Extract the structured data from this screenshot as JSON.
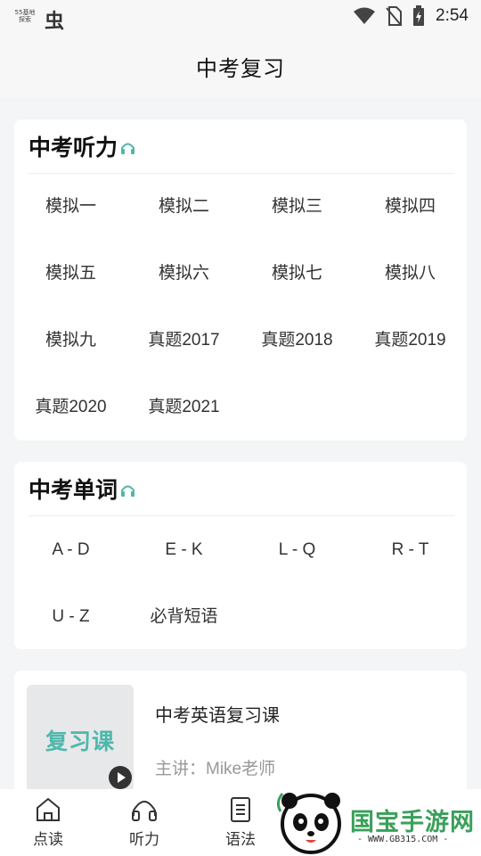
{
  "status_bar": {
    "mini_logo_line1": "55基地",
    "mini_logo_line2": "探索",
    "bug_glyph": "虫",
    "time": "2:54"
  },
  "header": {
    "title": "中考复习"
  },
  "listening": {
    "title": "中考听力",
    "items": [
      "模拟一",
      "模拟二",
      "模拟三",
      "模拟四",
      "模拟五",
      "模拟六",
      "模拟七",
      "模拟八",
      "模拟九",
      "真题2017",
      "真题2018",
      "真题2019",
      "真题2020",
      "真题2021"
    ]
  },
  "words": {
    "title": "中考单词",
    "items": [
      "A - D",
      "E - K",
      "L - Q",
      "R - T",
      "U - Z",
      "必背短语"
    ]
  },
  "course": {
    "thumb_text": "复习课",
    "title": "中考英语复习课",
    "teacher": "主讲：Mike老师"
  },
  "tabbar": {
    "items": [
      {
        "label": "点读",
        "icon": "home-icon"
      },
      {
        "label": "听力",
        "icon": "headphones-icon"
      },
      {
        "label": "语法",
        "icon": "document-icon"
      }
    ]
  },
  "watermark": {
    "brand": "国宝手游网",
    "url": "- WWW.GB315.COM -"
  },
  "colors": {
    "accent": "#4fb7ab",
    "watermark_green": "#3aa05a"
  }
}
